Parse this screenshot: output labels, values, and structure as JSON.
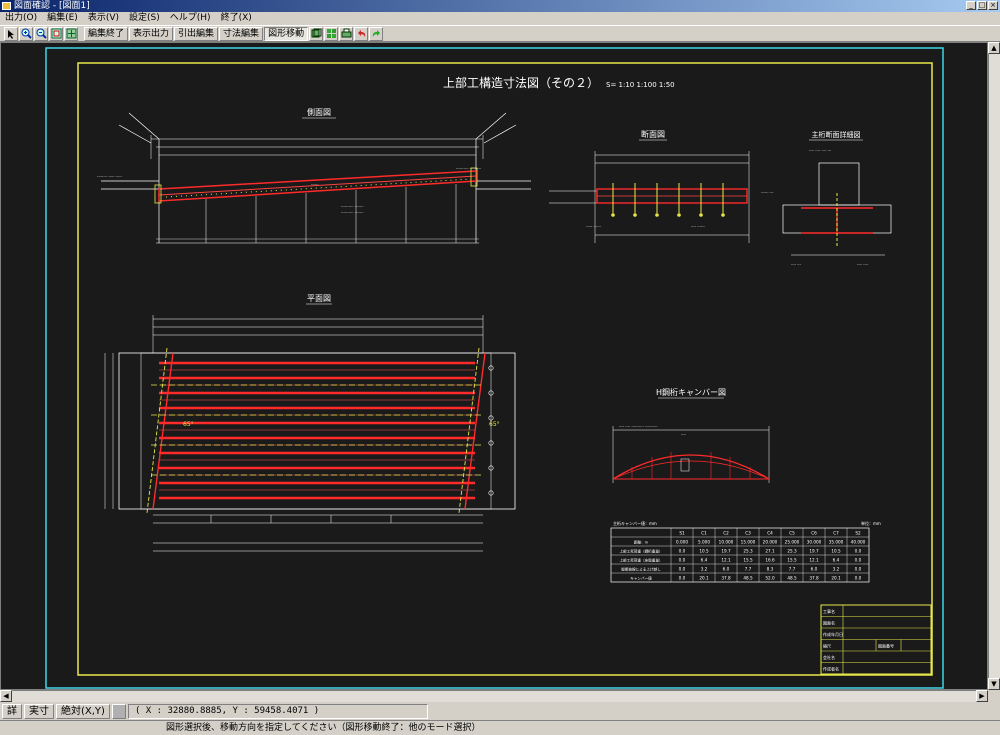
{
  "window": {
    "title": "図面確認 - [図面1]"
  },
  "menu": [
    "出力(O)",
    "編集(E)",
    "表示(V)",
    "設定(S)",
    "ヘルプ(H)",
    "終了(X)"
  ],
  "toolbar": {
    "buttons": [
      "編集終了",
      "表示出力",
      "引出編集",
      "寸法編集",
      "図形移動"
    ],
    "active": "図形移動"
  },
  "drawing": {
    "title": "上部工構造寸法図（その２）",
    "scale": "S= 1:10 1:100 1:50",
    "views": {
      "side": "側面図",
      "section": "断面図",
      "detail": "主桁断面詳細図",
      "plan": "平面図",
      "camber": "H鋼桁キャンバー図"
    },
    "skew_left": "65°",
    "skew_right": "65°",
    "table_caption": "主桁キャンバー値：mm",
    "table_unit": "単位：mm",
    "table": {
      "headers": [
        "",
        "S1",
        "C1",
        "C2",
        "C3",
        "C4",
        "C5",
        "C6",
        "C7",
        "S2"
      ],
      "rows": [
        [
          "距離：m",
          "0.000",
          "5.000",
          "10.000",
          "15.000",
          "20.000",
          "25.000",
          "30.000",
          "35.000",
          "40.000"
        ],
        [
          "上部工死荷重（鋼桁重量）",
          "0.0",
          "10.5",
          "19.7",
          "25.3",
          "27.1",
          "25.3",
          "19.7",
          "10.5",
          "0.0"
        ],
        [
          "上部工死荷重（床版重量）",
          "0.0",
          "6.4",
          "12.1",
          "15.5",
          "16.6",
          "15.5",
          "12.1",
          "6.4",
          "0.0"
        ],
        [
          "縦断曲線による上げ越し",
          "0.0",
          "3.2",
          "6.0",
          "7.7",
          "8.3",
          "7.7",
          "6.0",
          "3.2",
          "0.0"
        ],
        [
          "キャンバー値",
          "0.0",
          "20.1",
          "37.8",
          "48.5",
          "52.0",
          "48.5",
          "37.8",
          "20.1",
          "0.0"
        ]
      ]
    },
    "title_block": [
      "工事名",
      "図面名",
      "作成年月日",
      "縮尺",
      "図面番号",
      "会社名",
      "作成者名"
    ]
  },
  "status": {
    "mode1": "詳",
    "mode2": "実寸",
    "mode3": "絶対(X,Y)",
    "coords": "( X : 32880.8885, Y : 59458.4071 )",
    "message": "図形選択後、移動方向を指定してください（図形移動終了：他のモード選択）"
  }
}
